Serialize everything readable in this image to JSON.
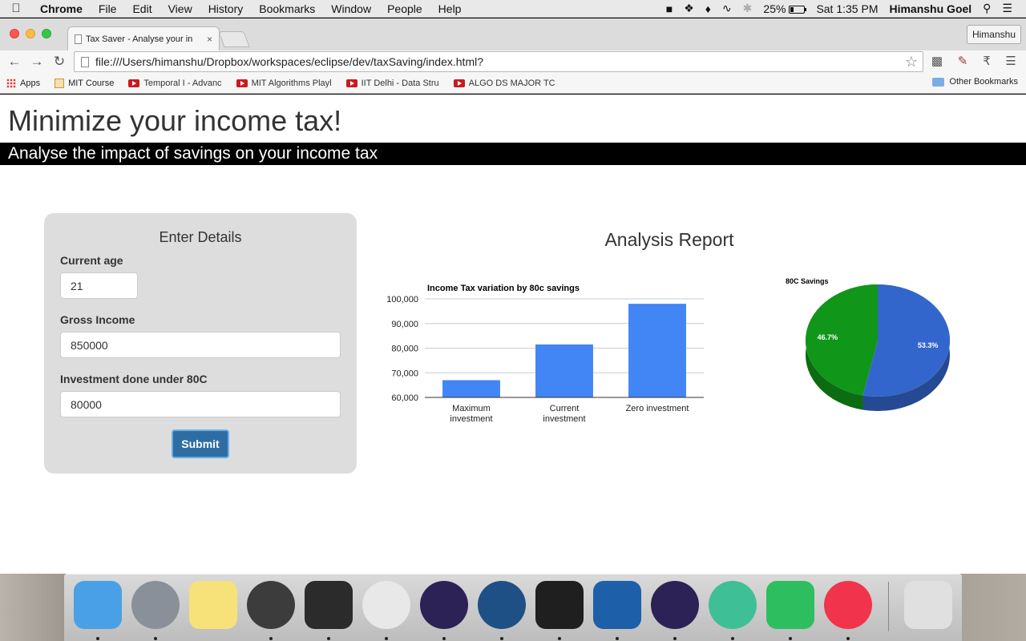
{
  "menubar": {
    "apple_icon": "apple-icon",
    "app_name": "Chrome",
    "items": [
      "File",
      "Edit",
      "View",
      "History",
      "Bookmarks",
      "Window",
      "People",
      "Help"
    ],
    "battery": "25%",
    "clock": "Sat 1:35 PM",
    "user": "Himanshu Goel"
  },
  "browser": {
    "tab_title": "Tax Saver - Analyse your in",
    "tab_close": "×",
    "profile": "Himanshu",
    "url": "file:///Users/himanshu/Dropbox/workspaces/eclipse/dev/taxSaving/index.html?",
    "bookmarks": [
      {
        "label": "Apps",
        "icon": "apps-grid-icon"
      },
      {
        "label": "MIT Course",
        "icon": "bookmark-page-icon"
      },
      {
        "label": "Temporal I - Advanc",
        "icon": "youtube-icon"
      },
      {
        "label": "MIT Algorithms Playl",
        "icon": "youtube-icon"
      },
      {
        "label": "IIT Delhi - Data Stru",
        "icon": "youtube-icon"
      },
      {
        "label": "ALGO DS MAJOR TC",
        "icon": "youtube-icon"
      }
    ],
    "other_bookmarks": "Other Bookmarks"
  },
  "page": {
    "title": "Minimize your income tax!",
    "subtitle": "Analyse the impact of savings on your income tax",
    "form": {
      "heading": "Enter Details",
      "age_label": "Current age",
      "age_value": "21",
      "income_label": "Gross Income",
      "income_value": "850000",
      "investment_label": "Investment done under 80C",
      "investment_value": "80000",
      "submit": "Submit"
    },
    "report_title": "Analysis Report"
  },
  "chart_data": [
    {
      "type": "bar",
      "title": "Income Tax variation by 80c savings",
      "categories": [
        "Maximum investment",
        "Current investment",
        "Zero investment"
      ],
      "values": [
        67000,
        81500,
        98000
      ],
      "ylim": [
        60000,
        100000
      ],
      "yticks": [
        "60,000",
        "70,000",
        "80,000",
        "90,000",
        "100,000"
      ],
      "grid": true,
      "color": "#4285f4"
    },
    {
      "type": "pie",
      "title": "80C Savings",
      "slices": [
        {
          "label": "53.3%",
          "value": 53.3,
          "color": "#3366cc"
        },
        {
          "label": "46.7%",
          "value": 46.7,
          "color": "#109618"
        }
      ]
    }
  ],
  "dock": {
    "apps": [
      {
        "name": "finder",
        "color": "#4aa0e6"
      },
      {
        "name": "launchpad",
        "color": "#8a9099"
      },
      {
        "name": "notes",
        "color": "#f7e27a"
      },
      {
        "name": "time-machine",
        "color": "#3c3c3c"
      },
      {
        "name": "terminal",
        "color": "#2b2b2b"
      },
      {
        "name": "chrome",
        "color": "#e8e8e8"
      },
      {
        "name": "eclipse",
        "color": "#2c2255"
      },
      {
        "name": "sourcetree",
        "color": "#1e4f85"
      },
      {
        "name": "activity-monitor",
        "color": "#1f1f1f"
      },
      {
        "name": "messaging",
        "color": "#1d5fa8"
      },
      {
        "name": "eclipse-2",
        "color": "#2c2255"
      },
      {
        "name": "atom",
        "color": "#3fbf95"
      },
      {
        "name": "evernote",
        "color": "#2dbe60"
      },
      {
        "name": "itunes",
        "color": "#f1344b"
      },
      {
        "name": "trash",
        "color": "#e0e0e0"
      }
    ]
  }
}
